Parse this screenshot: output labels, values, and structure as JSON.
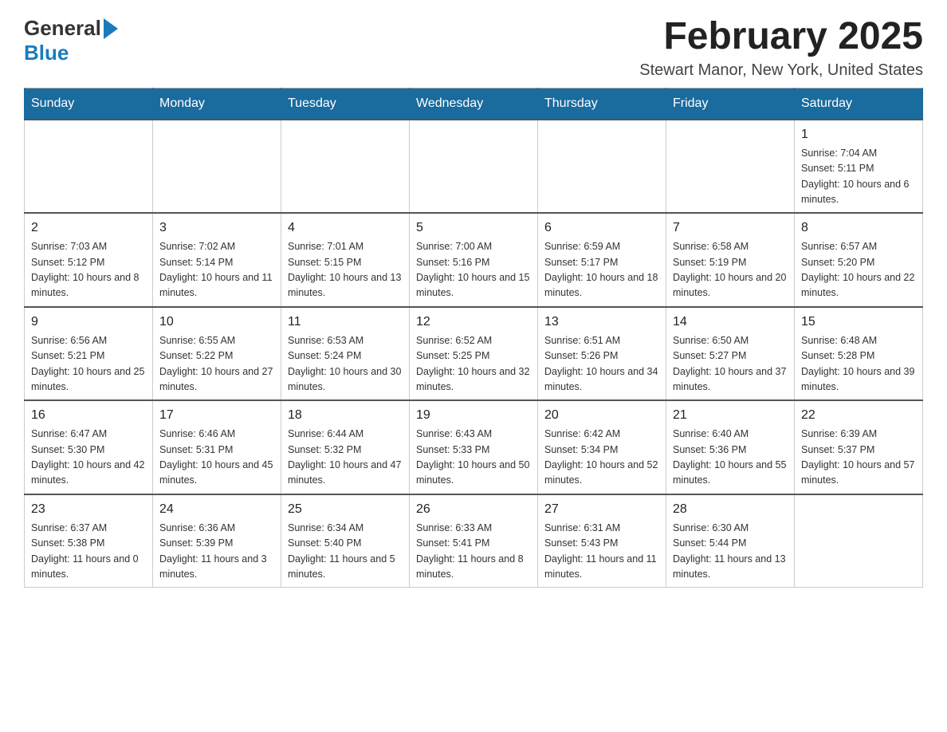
{
  "header": {
    "logo": {
      "general": "General",
      "blue": "Blue"
    },
    "title": "February 2025",
    "location": "Stewart Manor, New York, United States"
  },
  "days_of_week": [
    "Sunday",
    "Monday",
    "Tuesday",
    "Wednesday",
    "Thursday",
    "Friday",
    "Saturday"
  ],
  "weeks": [
    [
      {
        "day": "",
        "info": ""
      },
      {
        "day": "",
        "info": ""
      },
      {
        "day": "",
        "info": ""
      },
      {
        "day": "",
        "info": ""
      },
      {
        "day": "",
        "info": ""
      },
      {
        "day": "",
        "info": ""
      },
      {
        "day": "1",
        "info": "Sunrise: 7:04 AM\nSunset: 5:11 PM\nDaylight: 10 hours and 6 minutes."
      }
    ],
    [
      {
        "day": "2",
        "info": "Sunrise: 7:03 AM\nSunset: 5:12 PM\nDaylight: 10 hours and 8 minutes."
      },
      {
        "day": "3",
        "info": "Sunrise: 7:02 AM\nSunset: 5:14 PM\nDaylight: 10 hours and 11 minutes."
      },
      {
        "day": "4",
        "info": "Sunrise: 7:01 AM\nSunset: 5:15 PM\nDaylight: 10 hours and 13 minutes."
      },
      {
        "day": "5",
        "info": "Sunrise: 7:00 AM\nSunset: 5:16 PM\nDaylight: 10 hours and 15 minutes."
      },
      {
        "day": "6",
        "info": "Sunrise: 6:59 AM\nSunset: 5:17 PM\nDaylight: 10 hours and 18 minutes."
      },
      {
        "day": "7",
        "info": "Sunrise: 6:58 AM\nSunset: 5:19 PM\nDaylight: 10 hours and 20 minutes."
      },
      {
        "day": "8",
        "info": "Sunrise: 6:57 AM\nSunset: 5:20 PM\nDaylight: 10 hours and 22 minutes."
      }
    ],
    [
      {
        "day": "9",
        "info": "Sunrise: 6:56 AM\nSunset: 5:21 PM\nDaylight: 10 hours and 25 minutes."
      },
      {
        "day": "10",
        "info": "Sunrise: 6:55 AM\nSunset: 5:22 PM\nDaylight: 10 hours and 27 minutes."
      },
      {
        "day": "11",
        "info": "Sunrise: 6:53 AM\nSunset: 5:24 PM\nDaylight: 10 hours and 30 minutes."
      },
      {
        "day": "12",
        "info": "Sunrise: 6:52 AM\nSunset: 5:25 PM\nDaylight: 10 hours and 32 minutes."
      },
      {
        "day": "13",
        "info": "Sunrise: 6:51 AM\nSunset: 5:26 PM\nDaylight: 10 hours and 34 minutes."
      },
      {
        "day": "14",
        "info": "Sunrise: 6:50 AM\nSunset: 5:27 PM\nDaylight: 10 hours and 37 minutes."
      },
      {
        "day": "15",
        "info": "Sunrise: 6:48 AM\nSunset: 5:28 PM\nDaylight: 10 hours and 39 minutes."
      }
    ],
    [
      {
        "day": "16",
        "info": "Sunrise: 6:47 AM\nSunset: 5:30 PM\nDaylight: 10 hours and 42 minutes."
      },
      {
        "day": "17",
        "info": "Sunrise: 6:46 AM\nSunset: 5:31 PM\nDaylight: 10 hours and 45 minutes."
      },
      {
        "day": "18",
        "info": "Sunrise: 6:44 AM\nSunset: 5:32 PM\nDaylight: 10 hours and 47 minutes."
      },
      {
        "day": "19",
        "info": "Sunrise: 6:43 AM\nSunset: 5:33 PM\nDaylight: 10 hours and 50 minutes."
      },
      {
        "day": "20",
        "info": "Sunrise: 6:42 AM\nSunset: 5:34 PM\nDaylight: 10 hours and 52 minutes."
      },
      {
        "day": "21",
        "info": "Sunrise: 6:40 AM\nSunset: 5:36 PM\nDaylight: 10 hours and 55 minutes."
      },
      {
        "day": "22",
        "info": "Sunrise: 6:39 AM\nSunset: 5:37 PM\nDaylight: 10 hours and 57 minutes."
      }
    ],
    [
      {
        "day": "23",
        "info": "Sunrise: 6:37 AM\nSunset: 5:38 PM\nDaylight: 11 hours and 0 minutes."
      },
      {
        "day": "24",
        "info": "Sunrise: 6:36 AM\nSunset: 5:39 PM\nDaylight: 11 hours and 3 minutes."
      },
      {
        "day": "25",
        "info": "Sunrise: 6:34 AM\nSunset: 5:40 PM\nDaylight: 11 hours and 5 minutes."
      },
      {
        "day": "26",
        "info": "Sunrise: 6:33 AM\nSunset: 5:41 PM\nDaylight: 11 hours and 8 minutes."
      },
      {
        "day": "27",
        "info": "Sunrise: 6:31 AM\nSunset: 5:43 PM\nDaylight: 11 hours and 11 minutes."
      },
      {
        "day": "28",
        "info": "Sunrise: 6:30 AM\nSunset: 5:44 PM\nDaylight: 11 hours and 13 minutes."
      },
      {
        "day": "",
        "info": ""
      }
    ]
  ]
}
